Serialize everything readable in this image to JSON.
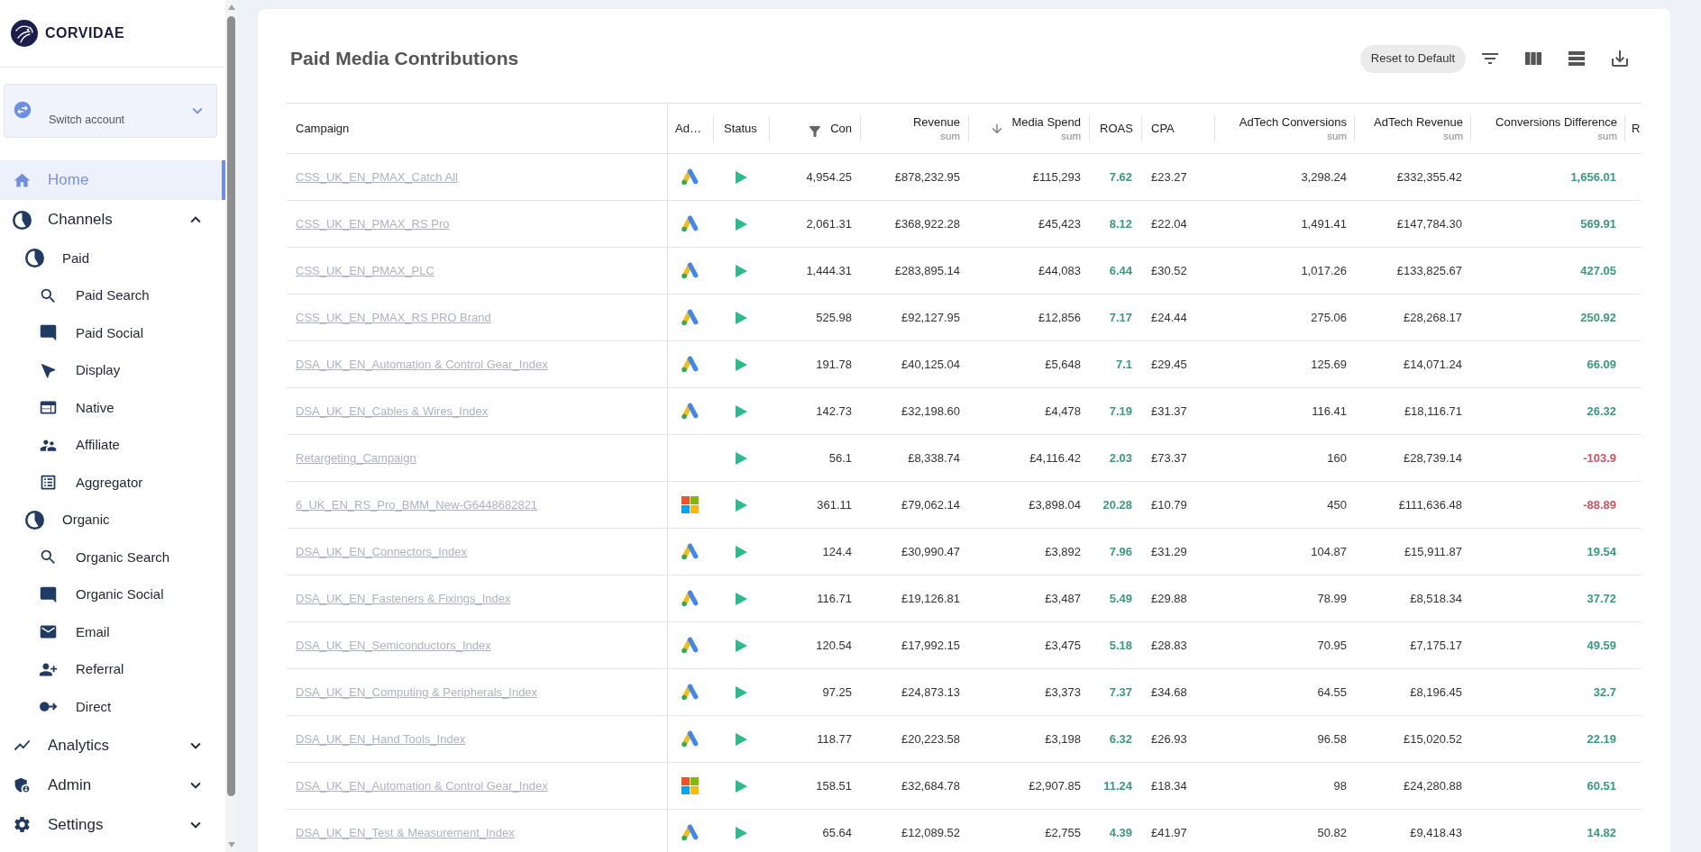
{
  "sidebar": {
    "logo": "CORVIDAE",
    "account_switcher": {
      "label": "Switch account",
      "expanded": false
    },
    "nav": [
      {
        "label": "Home",
        "selected": true
      },
      {
        "label": "Channels",
        "selected": false,
        "expanded": true,
        "children": [
          {
            "label": "Paid",
            "selected": false,
            "children": [
              {
                "label": "Paid Search",
                "selected": false
              },
              {
                "label": "Paid Social",
                "selected": false
              },
              {
                "label": "Display",
                "selected": false
              },
              {
                "label": "Native",
                "selected": false
              },
              {
                "label": "Affiliate",
                "selected": false
              },
              {
                "label": "Aggregator",
                "selected": false
              }
            ]
          },
          {
            "label": "Organic",
            "selected": false,
            "children": [
              {
                "label": "Organic Search",
                "selected": false
              },
              {
                "label": "Organic Social",
                "selected": false
              },
              {
                "label": "Email",
                "selected": false
              },
              {
                "label": "Referral",
                "selected": false
              },
              {
                "label": "Direct",
                "selected": false
              }
            ]
          }
        ]
      },
      {
        "label": "Analytics",
        "selected": false,
        "expanded": false
      },
      {
        "label": "Admin",
        "selected": false,
        "expanded": false
      },
      {
        "label": "Settings",
        "selected": false,
        "expanded": false
      }
    ]
  },
  "page": {
    "title": "Paid Media Contributions",
    "reset_label": "Reset to Default"
  },
  "table": {
    "columns": [
      {
        "label": "Campaign",
        "filtered": false,
        "sorted": false
      },
      {
        "label": "Ad…",
        "filtered": false,
        "sorted": false
      },
      {
        "label": "Status",
        "filtered": false,
        "sorted": false
      },
      {
        "label": "Con",
        "filtered": true,
        "sorted": false
      },
      {
        "label": "Revenue",
        "aggregate": "sum",
        "filtered": false,
        "sorted": false
      },
      {
        "label": "Media Spend",
        "aggregate": "sum",
        "filtered": false,
        "sorted": true
      },
      {
        "label": "ROAS",
        "filtered": false,
        "sorted": false
      },
      {
        "label": "CPA",
        "filtered": false,
        "sorted": false
      },
      {
        "label": "AdTech Conversions",
        "aggregate": "sum",
        "filtered": false,
        "sorted": false
      },
      {
        "label": "AdTech Revenue",
        "aggregate": "sum",
        "filtered": false,
        "sorted": false
      },
      {
        "label": "Conversions Difference",
        "aggregate": "sum",
        "filtered": false,
        "sorted": false
      },
      {
        "label": "R",
        "filtered": false,
        "sorted": false
      }
    ],
    "rows": [
      {
        "campaign": "CSS_UK_EN_PMAX_Catch All",
        "ad_icon": {
          "kind": "google"
        },
        "active": true,
        "conversions": "4,954.25",
        "revenue": "£878,232.95",
        "media_spend": "£115,293",
        "roas": "7.62",
        "cpa": "£23.27",
        "adtech_conversions": "3,298.24",
        "adtech_revenue": "£332,355.42",
        "conversions_difference": {
          "text": "1,656.01",
          "negative": false
        }
      },
      {
        "campaign": "CSS_UK_EN_PMAX_RS Pro",
        "ad_icon": {
          "kind": "google"
        },
        "active": true,
        "conversions": "2,061.31",
        "revenue": "£368,922.28",
        "media_spend": "£45,423",
        "roas": "8.12",
        "cpa": "£22.04",
        "adtech_conversions": "1,491.41",
        "adtech_revenue": "£147,784.30",
        "conversions_difference": {
          "text": "569.91",
          "negative": false
        }
      },
      {
        "campaign": "CSS_UK_EN_PMAX_PLC",
        "ad_icon": {
          "kind": "google"
        },
        "active": true,
        "conversions": "1,444.31",
        "revenue": "£283,895.14",
        "media_spend": "£44,083",
        "roas": "6.44",
        "cpa": "£30.52",
        "adtech_conversions": "1,017.26",
        "adtech_revenue": "£133,825.67",
        "conversions_difference": {
          "text": "427.05",
          "negative": false
        }
      },
      {
        "campaign": "CSS_UK_EN_PMAX_RS PRO Brand",
        "ad_icon": {
          "kind": "google"
        },
        "active": true,
        "conversions": "525.98",
        "revenue": "£92,127.95",
        "media_spend": "£12,856",
        "roas": "7.17",
        "cpa": "£24.44",
        "adtech_conversions": "275.06",
        "adtech_revenue": "£28,268.17",
        "conversions_difference": {
          "text": "250.92",
          "negative": false
        }
      },
      {
        "campaign": "DSA_UK_EN_Automation & Control Gear_Index",
        "ad_icon": {
          "kind": "google"
        },
        "active": true,
        "conversions": "191.78",
        "revenue": "£40,125.04",
        "media_spend": "£5,648",
        "roas": "7.1",
        "cpa": "£29.45",
        "adtech_conversions": "125.69",
        "adtech_revenue": "£14,071.24",
        "conversions_difference": {
          "text": "66.09",
          "negative": false
        }
      },
      {
        "campaign": "DSA_UK_EN_Cables & Wires_Index",
        "ad_icon": {
          "kind": "google"
        },
        "active": true,
        "conversions": "142.73",
        "revenue": "£32,198.60",
        "media_spend": "£4,478",
        "roas": "7.19",
        "cpa": "£31.37",
        "adtech_conversions": "116.41",
        "adtech_revenue": "£18,116.71",
        "conversions_difference": {
          "text": "26.32",
          "negative": false
        }
      },
      {
        "campaign": "Retargeting_Campaign",
        "active": true,
        "conversions": "56.1",
        "revenue": "£8,338.74",
        "media_spend": "£4,116.42",
        "roas": "2.03",
        "cpa": "£73.37",
        "adtech_conversions": "160",
        "adtech_revenue": "£28,739.14",
        "conversions_difference": {
          "text": "-103.9",
          "negative": true
        }
      },
      {
        "campaign": "6_UK_EN_RS_Pro_BMM_New-G6448682821",
        "ad_icon": {
          "kind": "microsoft"
        },
        "active": true,
        "conversions": "361.11",
        "revenue": "£79,062.14",
        "media_spend": "£3,898.04",
        "roas": "20.28",
        "cpa": "£10.79",
        "adtech_conversions": "450",
        "adtech_revenue": "£111,636.48",
        "conversions_difference": {
          "text": "-88.89",
          "negative": true
        }
      },
      {
        "campaign": "DSA_UK_EN_Connectors_Index",
        "ad_icon": {
          "kind": "google"
        },
        "active": true,
        "conversions": "124.4",
        "revenue": "£30,990.47",
        "media_spend": "£3,892",
        "roas": "7.96",
        "cpa": "£31.29",
        "adtech_conversions": "104.87",
        "adtech_revenue": "£15,911.87",
        "conversions_difference": {
          "text": "19.54",
          "negative": false
        }
      },
      {
        "campaign": "DSA_UK_EN_Fasteners & Fixings_Index",
        "ad_icon": {
          "kind": "google"
        },
        "active": true,
        "conversions": "116.71",
        "revenue": "£19,126.81",
        "media_spend": "£3,487",
        "roas": "5.49",
        "cpa": "£29.88",
        "adtech_conversions": "78.99",
        "adtech_revenue": "£8,518.34",
        "conversions_difference": {
          "text": "37.72",
          "negative": false
        }
      },
      {
        "campaign": "DSA_UK_EN_Semiconductors_Index",
        "ad_icon": {
          "kind": "google"
        },
        "active": true,
        "conversions": "120.54",
        "revenue": "£17,992.15",
        "media_spend": "£3,475",
        "roas": "5.18",
        "cpa": "£28.83",
        "adtech_conversions": "70.95",
        "adtech_revenue": "£7,175.17",
        "conversions_difference": {
          "text": "49.59",
          "negative": false
        }
      },
      {
        "campaign": "DSA_UK_EN_Computing & Peripherals_Index",
        "ad_icon": {
          "kind": "google"
        },
        "active": true,
        "conversions": "97.25",
        "revenue": "£24,873.13",
        "media_spend": "£3,373",
        "roas": "7.37",
        "cpa": "£34.68",
        "adtech_conversions": "64.55",
        "adtech_revenue": "£8,196.45",
        "conversions_difference": {
          "text": "32.7",
          "negative": false
        }
      },
      {
        "campaign": "DSA_UK_EN_Hand Tools_Index",
        "ad_icon": {
          "kind": "google"
        },
        "active": true,
        "conversions": "118.77",
        "revenue": "£20,223.58",
        "media_spend": "£3,198",
        "roas": "6.32",
        "cpa": "£26.93",
        "adtech_conversions": "96.58",
        "adtech_revenue": "£15,020.52",
        "conversions_difference": {
          "text": "22.19",
          "negative": false
        }
      },
      {
        "campaign": "DSA_UK_EN_Automation & Control Gear_Index",
        "ad_icon": {
          "kind": "microsoft"
        },
        "active": true,
        "conversions": "158.51",
        "revenue": "£32,684.78",
        "media_spend": "£2,907.85",
        "roas": "11.24",
        "cpa": "£18.34",
        "adtech_conversions": "98",
        "adtech_revenue": "£24,280.88",
        "conversions_difference": {
          "text": "60.51",
          "negative": false
        }
      },
      {
        "campaign": "DSA_UK_EN_Test & Measurement_Index",
        "ad_icon": {
          "kind": "google"
        },
        "active": true,
        "conversions": "65.64",
        "revenue": "£12,089.52",
        "media_spend": "£2,755",
        "roas": "4.39",
        "cpa": "£41.97",
        "adtech_conversions": "50.82",
        "adtech_revenue": "£9,418.43",
        "conversions_difference": {
          "text": "14.82",
          "negative": false
        }
      }
    ]
  }
}
